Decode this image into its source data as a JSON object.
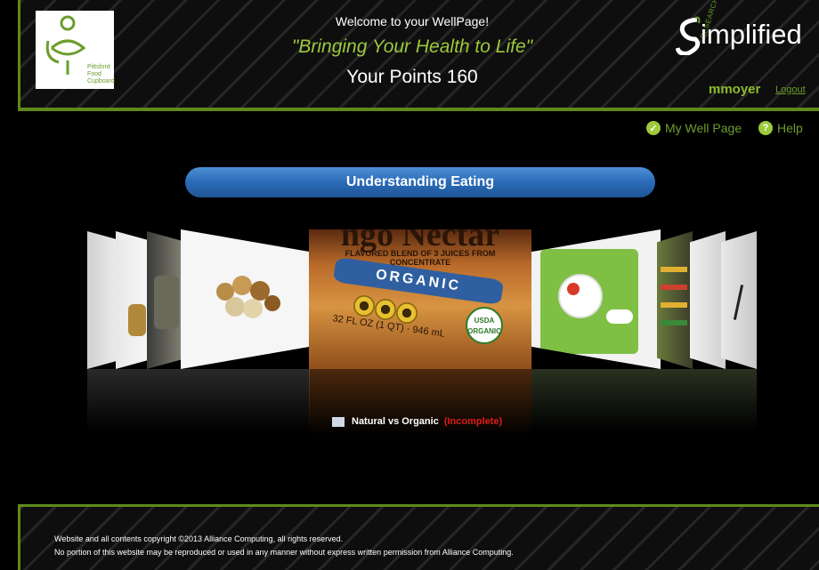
{
  "header": {
    "welcome": "Welcome to your WellPage!",
    "tagline": "\"Bringing Your Health to Life\"",
    "points": "Your Points 160",
    "logo_lines": [
      "Pittsford",
      "Food",
      "Cupboard"
    ],
    "brand_small": "RESEARCH",
    "brand_s": "S",
    "brand_rest": "implified",
    "username": "mmoyer",
    "logout": "Logout"
  },
  "nav": {
    "wellpage": "My Well Page",
    "help": "Help",
    "wellpage_icon": "check-icon",
    "help_icon": "question-icon"
  },
  "section": {
    "title": "Understanding Eating"
  },
  "carousel": {
    "center_card": {
      "title": "Natural vs Organic",
      "status": "(Incomplete)",
      "image_text_top": "ngo Nectar",
      "image_text_sub": "FLAVORED BLEND OF 3 JUICES FROM CONCENTRATE",
      "image_organic": "ORGANIC",
      "image_volume": "32 FL OZ (1 QT) · 946 mL",
      "image_usda": "USDA ORGANIC"
    }
  },
  "footer": {
    "line1": "Website and all contents copyright ©2013 Alliance Computing, all rights reserved.",
    "line2": "No portion of this website may be reproduced or used in any manner without express written permission from Alliance Computing."
  },
  "colors": {
    "accent_green": "#9dc93a",
    "banner_blue": "#2a6bb7",
    "status_red": "#e01b1b"
  }
}
